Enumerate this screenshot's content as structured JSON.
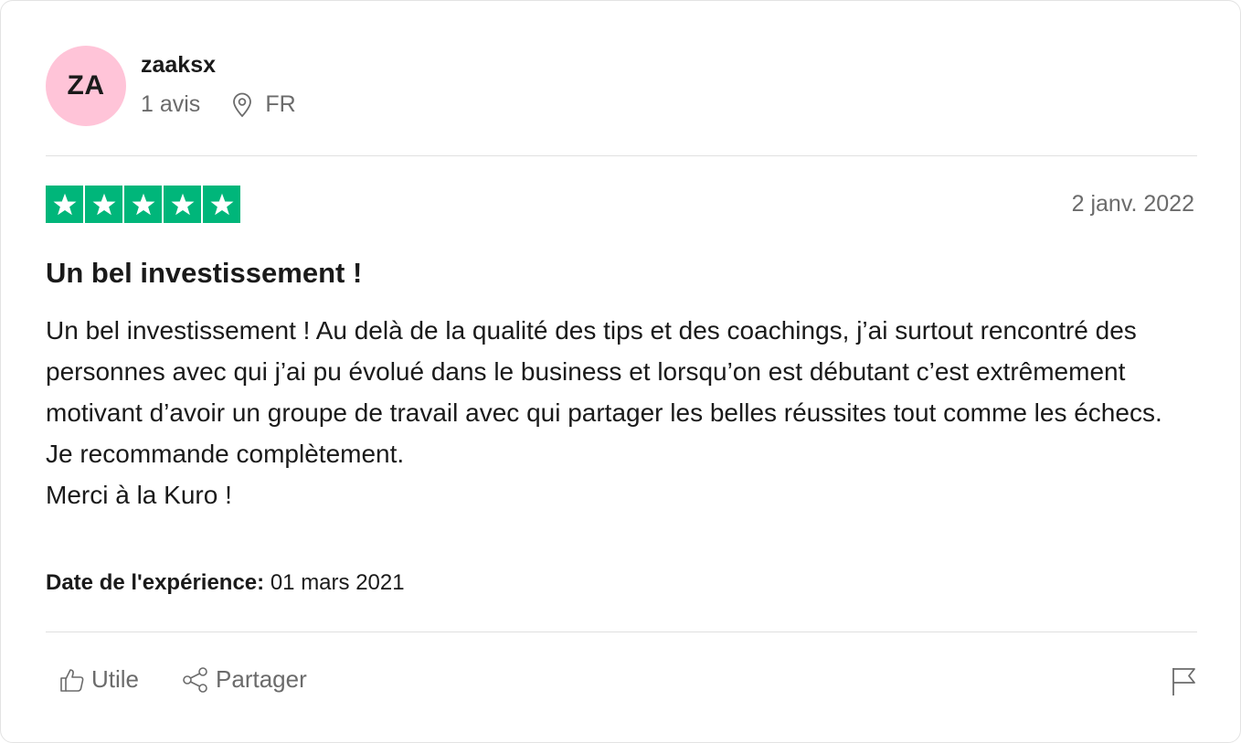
{
  "reviewer": {
    "initials": "ZA",
    "avatar_color": "#ffc4d8",
    "name": "zaaksx",
    "review_count": "1 avis",
    "country": "FR"
  },
  "review": {
    "rating": 5,
    "star_color": "#00b67a",
    "date": "2 janv. 2022",
    "title": "Un bel investissement !",
    "body": [
      "Un bel investissement ! Au delà de la qualité des tips et des coachings, j’ai surtout rencontré des personnes avec qui j’ai pu évolué dans le business et lorsqu’on est débutant c’est extrêmement motivant d’avoir un groupe de travail avec qui partager les belles réussites tout comme les échecs.",
      "Je recommande complètement.",
      "Merci à la Kuro !"
    ],
    "experience_label": "Date de l'expérience:",
    "experience_date": "01 mars 2021"
  },
  "actions": {
    "useful_label": "Utile",
    "share_label": "Partager"
  },
  "icons": {
    "location": "location-pin-icon",
    "useful": "thumbs-up-icon",
    "share": "share-icon",
    "report": "flag-icon",
    "star": "star-icon"
  }
}
